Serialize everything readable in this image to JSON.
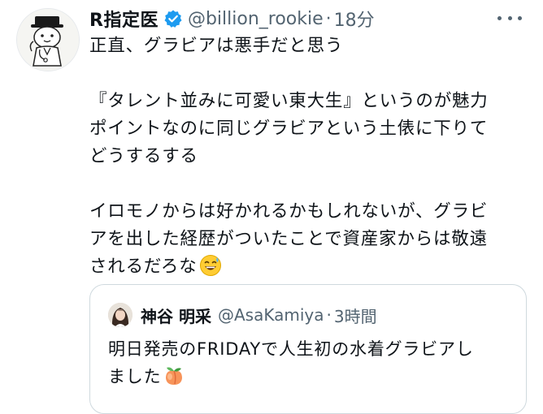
{
  "tweet": {
    "author": {
      "display_name": "R指定医",
      "handle": "@billion_rookie",
      "separator": "·",
      "time": "18分",
      "verified_icon": "verified-badge-icon"
    },
    "more_icon": "more-horizontal-icon",
    "body_lines": [
      "正直、グラビアは悪手だと思う",
      "",
      "『タレント並みに可愛い東大生』というのが魅力",
      "ポイントなのに同じグラビアという土俵に下りて",
      "どうするする",
      "",
      "イロモノからは好かれるかもしれないが、グラビ",
      "アを出した経歴がついたことで資産家からは敬遠",
      "されるだろな"
    ],
    "body_emoji": "grinning-face-with-sweat-icon"
  },
  "quoted_tweet": {
    "author": {
      "display_name": "神谷 明采",
      "handle": "@AsaKamiya",
      "separator": "·",
      "time": "3時間"
    },
    "body_lines": [
      "明日発売のFRIDAYで人生初の水着グラビアし",
      "ました"
    ],
    "body_emoji": "peach-icon"
  },
  "colors": {
    "text_primary": "#0f1419",
    "text_secondary": "#536471",
    "verified_blue": "#1d9bf0",
    "border": "#cfd9de"
  }
}
